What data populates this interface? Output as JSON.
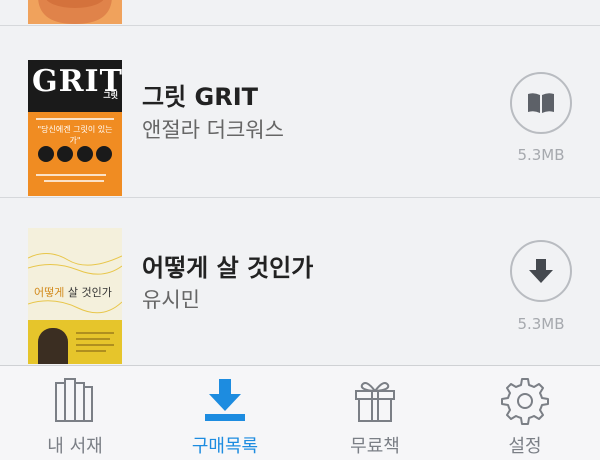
{
  "books": [
    {
      "title": "그릿 GRIT",
      "author": "앤절라 더크워스",
      "size": "5.3MB",
      "action_icon": "book-open-icon",
      "cover": {
        "word": "GRIT",
        "subtitle": "그릿",
        "tagline": "\"당신에겐 그릿이 있는가\"",
        "colors": {
          "top": "#1a1a1a",
          "bottom": "#f08c22"
        }
      }
    },
    {
      "title": "어떻게 살 것인가",
      "author": "유시민",
      "size": "5.3MB",
      "action_icon": "download-arrow-icon",
      "cover": {
        "title_highlight": "어떻게",
        "title_rest": " 살 것인가",
        "colors": {
          "top": "#f4f0dc",
          "bottom": "#e6c52b"
        }
      }
    }
  ],
  "tabbar": {
    "tabs": [
      {
        "label": "내 서재",
        "icon": "library-books-icon",
        "active": false
      },
      {
        "label": "구매목록",
        "icon": "download-tray-icon",
        "active": true
      },
      {
        "label": "무료책",
        "icon": "gift-icon",
        "active": false
      },
      {
        "label": "설정",
        "icon": "gear-icon",
        "active": false
      }
    ]
  },
  "colors": {
    "accent": "#1d8ce0",
    "inactive": "#7b7f86",
    "background": "#f1f2f4"
  }
}
